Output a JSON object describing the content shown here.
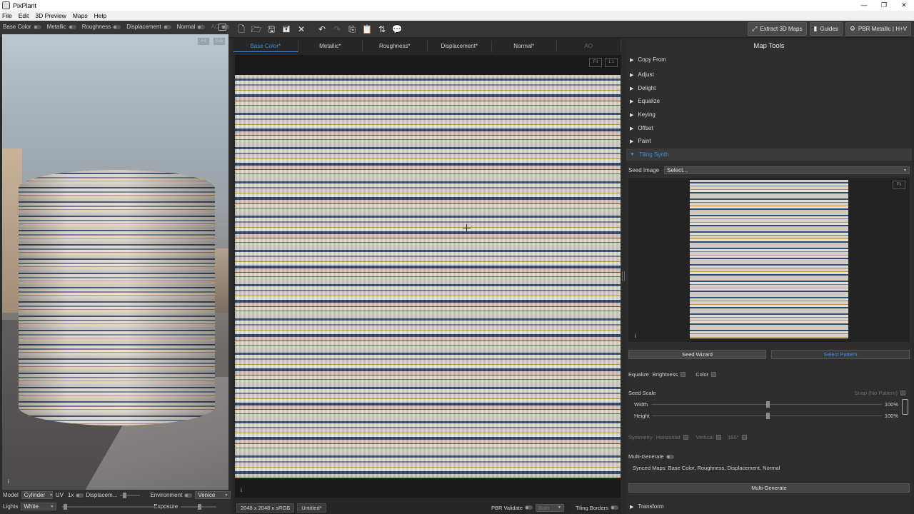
{
  "window": {
    "title": "PixPlant",
    "controls": [
      "—",
      "❐",
      "✕"
    ]
  },
  "menu": [
    "File",
    "Edit",
    "3D Preview",
    "Maps",
    "Help"
  ],
  "viewport_toggles": [
    {
      "label": "Base Color",
      "enabled": true
    },
    {
      "label": "Metallic",
      "enabled": true
    },
    {
      "label": "Roughness",
      "enabled": true
    },
    {
      "label": "Displacement",
      "enabled": true
    },
    {
      "label": "Normal",
      "enabled": true
    },
    {
      "label": "AO",
      "enabled": false
    }
  ],
  "viewport_buttons": [
    "Fit",
    "Sub"
  ],
  "toolbar_icons": [
    "new-file-icon",
    "open-folder-icon",
    "save-icon",
    "save-as-icon",
    "close-icon",
    "undo-icon",
    "redo-icon",
    "copy-icon",
    "paste-icon",
    "swap-icon",
    "comment-icon"
  ],
  "top_right": {
    "extract": "Extract 3D Maps",
    "guides": "Guides",
    "mode": "PBR Metallic | H+V"
  },
  "viewport_bottom": {
    "model_label": "Model",
    "model_value": "Cylinder",
    "uv_label": "UV",
    "uv_value": "1x",
    "displacement_label": "Displacem...",
    "environment_label": "Environment",
    "environment_value": "Venice",
    "lights_label": "Lights",
    "lights_value": "White",
    "exposure_label": "Exposure"
  },
  "map_tabs": [
    "Base Color*",
    "Metallic*",
    "Roughness*",
    "Displacement*",
    "Normal*",
    "AO"
  ],
  "active_tab": "Base Color*",
  "editor_buttons": [
    "Fit",
    "1:1"
  ],
  "status": {
    "resolution": "2048 x 2048 x sRGB",
    "doc": "Untitled*",
    "pbr_validate": "PBR Validate",
    "pbr_mode": "Both",
    "tiling_borders": "Tiling Borders"
  },
  "tools": {
    "title": "Map Tools",
    "sections": [
      "Copy From",
      "Adjust",
      "Delight",
      "Equalize",
      "Keying",
      "Offset",
      "Paint"
    ],
    "open_section": "Tiling Synth",
    "seed_image_label": "Seed Image",
    "seed_image_value": "Select...",
    "preview_fit": "Fit",
    "seed_wizard": "Seed Wizard",
    "select_pattern": "Select Pattern",
    "equalize_label": "Equalize",
    "brightness_label": "Brightness",
    "color_label": "Color",
    "seed_scale_label": "Seed Scale",
    "snap_label": "Snap (No Pattern)",
    "width_label": "Width",
    "width_value": "100%",
    "height_label": "Height",
    "height_value": "100%",
    "symmetry_label": "Symmetry",
    "horizontal_label": "Horizontal",
    "vertical_label": "Vertical",
    "deg180_label": "180°",
    "multi_generate_label": "Multi-Generate",
    "synced_maps": "Synced Maps: Base Color, Roughness, Displacement, Normal",
    "multi_generate_button": "Multi-Generate",
    "transform": "Transform"
  }
}
